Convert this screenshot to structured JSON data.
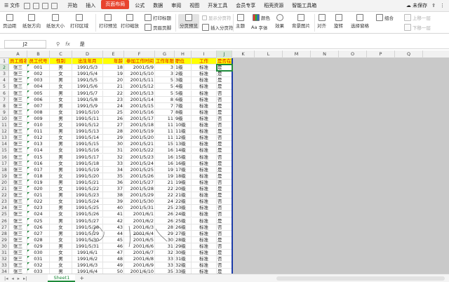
{
  "menubar": {
    "file": "文件",
    "items": [
      "开始",
      "插入",
      "页面布局",
      "公式",
      "数据",
      "审阅",
      "视图",
      "开发工具",
      "会员专享",
      "稻壳资源",
      "智能工具箱"
    ],
    "active_index": 2,
    "cloud_status": "未保存"
  },
  "ribbon": {
    "margins": "页边距",
    "orientation": "纸张方向",
    "size": "纸张大小",
    "print_area": "打印区域",
    "print_preview": "打印预览",
    "print_scale": "打印缩放",
    "print_titles": "打印标题",
    "header_footer": "页眉页脚",
    "page_break_preview": "分页预览",
    "show_page_breaks": "显示分页符",
    "insert_page_break": "插入分页符",
    "theme": "主题",
    "font": "字体",
    "effects": "效果",
    "background": "背景图片",
    "align": "对齐",
    "rotate": "旋转",
    "selection_pane": "选择窗格",
    "group": "组合",
    "bring_forward": "上移一层",
    "send_backward": "下移一层",
    "colors_label": "颜色"
  },
  "formula": {
    "name_box": "J2",
    "value": "是"
  },
  "columns": [
    "A",
    "B",
    "C",
    "D",
    "E",
    "F",
    "G",
    "H",
    "I",
    "J",
    "K",
    "L",
    "M",
    "N",
    "O",
    "P",
    "Q"
  ],
  "table": {
    "headers": [
      "员工姓名",
      "员工代号",
      "性别",
      "出生年月",
      "年龄",
      "参加工作时间",
      "工作年限",
      "职位",
      "工作",
      "是否在职"
    ],
    "rows": [
      [
        "张三",
        "001",
        "男",
        "1991/5/3",
        "18",
        "2001/5/9",
        "3",
        "1级",
        "标准",
        "是"
      ],
      [
        "张三",
        "002",
        "女",
        "1991/5/4",
        "19",
        "2001/5/10",
        "3",
        "2级",
        "标准",
        "是"
      ],
      [
        "张三",
        "003",
        "男",
        "1991/5/5",
        "20",
        "2001/5/11",
        "5",
        "3级",
        "标准",
        "是"
      ],
      [
        "张三",
        "004",
        "女",
        "1991/5/6",
        "21",
        "2001/5/12",
        "5",
        "4级",
        "标准",
        "是"
      ],
      [
        "张三",
        "005",
        "男",
        "1991/5/7",
        "22",
        "2001/5/13",
        "5",
        "5级",
        "标准",
        "否"
      ],
      [
        "张三",
        "006",
        "女",
        "1991/5/8",
        "23",
        "2001/5/14",
        "8",
        "6级",
        "标准",
        "否"
      ],
      [
        "张三",
        "007",
        "男",
        "1991/5/9",
        "24",
        "2001/5/15",
        "7",
        "7级",
        "标准",
        "是"
      ],
      [
        "张三",
        "008",
        "女",
        "1991/5/10",
        "25",
        "2001/5/16",
        "7",
        "8级",
        "标准",
        "是"
      ],
      [
        "张三",
        "009",
        "男",
        "1991/5/11",
        "26",
        "2001/5/17",
        "11",
        "9级",
        "标准",
        "否"
      ],
      [
        "张三",
        "010",
        "女",
        "1991/5/12",
        "27",
        "2001/5/18",
        "11",
        "10级",
        "标准",
        "否"
      ],
      [
        "张三",
        "011",
        "男",
        "1991/5/13",
        "28",
        "2001/5/19",
        "11",
        "11级",
        "标准",
        "是"
      ],
      [
        "张三",
        "012",
        "女",
        "1991/5/14",
        "29",
        "2001/5/20",
        "11",
        "12级",
        "标准",
        "否"
      ],
      [
        "张三",
        "013",
        "男",
        "1991/5/15",
        "30",
        "2001/5/21",
        "15",
        "13级",
        "标准",
        "是"
      ],
      [
        "张三",
        "014",
        "女",
        "1991/5/16",
        "31",
        "2001/5/22",
        "16",
        "14级",
        "标准",
        "是"
      ],
      [
        "张三",
        "015",
        "男",
        "1991/5/17",
        "32",
        "2001/5/23",
        "16",
        "15级",
        "标准",
        "否"
      ],
      [
        "张三",
        "016",
        "女",
        "1991/5/18",
        "33",
        "2001/5/24",
        "16",
        "16级",
        "标准",
        "是"
      ],
      [
        "张三",
        "017",
        "男",
        "1991/5/19",
        "34",
        "2001/5/25",
        "19",
        "17级",
        "标准",
        "是"
      ],
      [
        "张三",
        "018",
        "女",
        "1991/5/20",
        "35",
        "2001/5/26",
        "19",
        "18级",
        "标准",
        "是"
      ],
      [
        "张三",
        "019",
        "男",
        "1991/5/21",
        "36",
        "2001/5/27",
        "21",
        "19级",
        "标准",
        "否"
      ],
      [
        "张三",
        "020",
        "女",
        "1991/5/22",
        "37",
        "2001/5/28",
        "22",
        "20级",
        "标准",
        "是"
      ],
      [
        "张三",
        "021",
        "男",
        "1991/5/23",
        "38",
        "2001/5/29",
        "22",
        "21级",
        "标准",
        "是"
      ],
      [
        "张三",
        "022",
        "女",
        "1991/5/24",
        "39",
        "2001/5/30",
        "24",
        "22级",
        "标准",
        "否"
      ],
      [
        "张三",
        "023",
        "男",
        "1991/5/25",
        "40",
        "2001/5/31",
        "25",
        "23级",
        "标准",
        "否"
      ],
      [
        "张三",
        "024",
        "女",
        "1991/5/26",
        "41",
        "2001/6/1",
        "26",
        "24级",
        "标准",
        "否"
      ],
      [
        "张三",
        "025",
        "男",
        "1991/5/27",
        "42",
        "2001/6/2",
        "26",
        "25级",
        "标准",
        "是"
      ],
      [
        "张三",
        "026",
        "女",
        "1991/5/28",
        "43",
        "2001/6/3",
        "28",
        "26级",
        "标准",
        "否"
      ],
      [
        "张三",
        "027",
        "男",
        "1991/5/29",
        "44",
        "2001/6/4",
        "29",
        "27级",
        "标准",
        "否"
      ],
      [
        "张三",
        "028",
        "女",
        "1991/5/30",
        "45",
        "2001/6/5",
        "30",
        "28级",
        "标准",
        "是"
      ],
      [
        "张三",
        "029",
        "男",
        "1991/5/31",
        "46",
        "2001/6/6",
        "31",
        "29级",
        "标准",
        "否"
      ],
      [
        "张三",
        "030",
        "女",
        "1991/6/1",
        "47",
        "2001/6/7",
        "32",
        "30级",
        "标准",
        "是"
      ],
      [
        "张三",
        "031",
        "男",
        "1991/6/2",
        "48",
        "2001/6/8",
        "33",
        "31级",
        "标准",
        "否"
      ],
      [
        "张三",
        "032",
        "女",
        "1991/6/3",
        "49",
        "2001/6/9",
        "33",
        "32级",
        "标准",
        "否"
      ],
      [
        "张三",
        "033",
        "男",
        "1991/6/4",
        "50",
        "2001/6/10",
        "35",
        "33级",
        "标准",
        "是"
      ]
    ]
  },
  "sheet_tab": "Sheet1",
  "colors": {
    "accent": "#1e8a3a",
    "header_fill": "#ffff00",
    "header_text": "#e00000",
    "active_menu": "#e8432e",
    "page_border": "#1b3aa8"
  }
}
